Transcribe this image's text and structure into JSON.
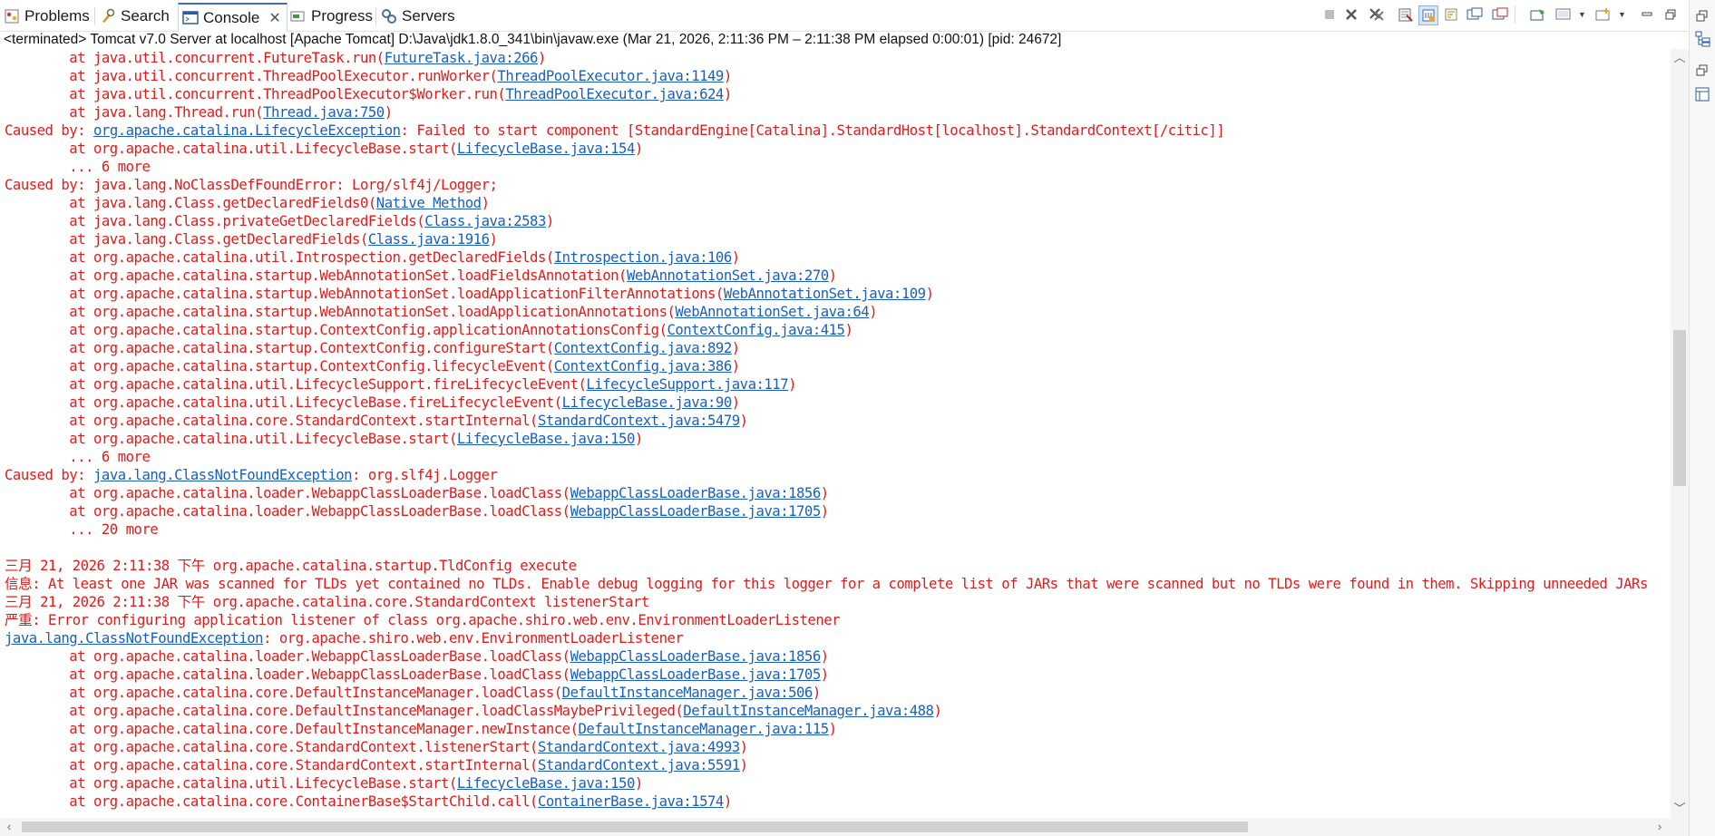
{
  "tabs": [
    {
      "label": "Problems",
      "icon": "problems-icon"
    },
    {
      "label": "Search",
      "icon": "search-icon"
    },
    {
      "label": "Console",
      "icon": "console-icon",
      "active": true
    },
    {
      "label": "Progress",
      "icon": "progress-icon"
    },
    {
      "label": "Servers",
      "icon": "servers-icon"
    }
  ],
  "toolbar_icons": [
    "terminate-icon",
    "remove-launch-icon",
    "remove-all-terminated-icon",
    "clear-console-icon",
    "scroll-lock-icon",
    "word-wrap-icon",
    "show-when-stdout-icon",
    "show-when-stderr-icon",
    "pin-console-icon",
    "display-selected-console-icon",
    "open-console-icon",
    "minimize-icon",
    "maximize-icon"
  ],
  "title": "<terminated> Tomcat v7.0 Server at localhost [Apache Tomcat] D:\\Java\\jdk1.8.0_341\\bin\\javaw.exe  (Mar 21, 2026, 2:11:36 PM – 2:11:38 PM elapsed 0:00:01) [pid: 24672]",
  "colors": {
    "error_text": "#e01b1b",
    "link": "#1a5fbf",
    "active_tab_accent": "#3a6fc4"
  },
  "lines": [
    {
      "pre": "        at java.util.concurrent.FutureTask.run(",
      "link": "FutureTask.java:266",
      "post": ")"
    },
    {
      "pre": "        at java.util.concurrent.ThreadPoolExecutor.runWorker(",
      "link": "ThreadPoolExecutor.java:1149",
      "post": ")"
    },
    {
      "pre": "        at java.util.concurrent.ThreadPoolExecutor$Worker.run(",
      "link": "ThreadPoolExecutor.java:624",
      "post": ")"
    },
    {
      "pre": "        at java.lang.Thread.run(",
      "link": "Thread.java:750",
      "post": ")"
    },
    {
      "pre": "Caused by: ",
      "link": "org.apache.catalina.LifecycleException",
      "post": ": Failed to start component [StandardEngine[Catalina].StandardHost[localhost].StandardContext[/citic]]"
    },
    {
      "pre": "        at org.apache.catalina.util.LifecycleBase.start(",
      "link": "LifecycleBase.java:154",
      "post": ")"
    },
    {
      "pre": "        ... 6 more",
      "link": "",
      "post": ""
    },
    {
      "pre": "Caused by: java.lang.NoClassDefFoundError: Lorg/slf4j/Logger;",
      "link": "",
      "post": ""
    },
    {
      "pre": "        at java.lang.Class.getDeclaredFields0(",
      "link": "Native Method",
      "post": ")"
    },
    {
      "pre": "        at java.lang.Class.privateGetDeclaredFields(",
      "link": "Class.java:2583",
      "post": ")"
    },
    {
      "pre": "        at java.lang.Class.getDeclaredFields(",
      "link": "Class.java:1916",
      "post": ")"
    },
    {
      "pre": "        at org.apache.catalina.util.Introspection.getDeclaredFields(",
      "link": "Introspection.java:106",
      "post": ")"
    },
    {
      "pre": "        at org.apache.catalina.startup.WebAnnotationSet.loadFieldsAnnotation(",
      "link": "WebAnnotationSet.java:270",
      "post": ")"
    },
    {
      "pre": "        at org.apache.catalina.startup.WebAnnotationSet.loadApplicationFilterAnnotations(",
      "link": "WebAnnotationSet.java:109",
      "post": ")"
    },
    {
      "pre": "        at org.apache.catalina.startup.WebAnnotationSet.loadApplicationAnnotations(",
      "link": "WebAnnotationSet.java:64",
      "post": ")"
    },
    {
      "pre": "        at org.apache.catalina.startup.ContextConfig.applicationAnnotationsConfig(",
      "link": "ContextConfig.java:415",
      "post": ")"
    },
    {
      "pre": "        at org.apache.catalina.startup.ContextConfig.configureStart(",
      "link": "ContextConfig.java:892",
      "post": ")"
    },
    {
      "pre": "        at org.apache.catalina.startup.ContextConfig.lifecycleEvent(",
      "link": "ContextConfig.java:386",
      "post": ")"
    },
    {
      "pre": "        at org.apache.catalina.util.LifecycleSupport.fireLifecycleEvent(",
      "link": "LifecycleSupport.java:117",
      "post": ")"
    },
    {
      "pre": "        at org.apache.catalina.util.LifecycleBase.fireLifecycleEvent(",
      "link": "LifecycleBase.java:90",
      "post": ")"
    },
    {
      "pre": "        at org.apache.catalina.core.StandardContext.startInternal(",
      "link": "StandardContext.java:5479",
      "post": ")"
    },
    {
      "pre": "        at org.apache.catalina.util.LifecycleBase.start(",
      "link": "LifecycleBase.java:150",
      "post": ")"
    },
    {
      "pre": "        ... 6 more",
      "link": "",
      "post": ""
    },
    {
      "pre": "Caused by: ",
      "link": "java.lang.ClassNotFoundException",
      "post": ": org.slf4j.Logger"
    },
    {
      "pre": "        at org.apache.catalina.loader.WebappClassLoaderBase.loadClass(",
      "link": "WebappClassLoaderBase.java:1856",
      "post": ")"
    },
    {
      "pre": "        at org.apache.catalina.loader.WebappClassLoaderBase.loadClass(",
      "link": "WebappClassLoaderBase.java:1705",
      "post": ")"
    },
    {
      "pre": "        ... 20 more",
      "link": "",
      "post": ""
    },
    {
      "pre": "",
      "link": "",
      "post": ""
    },
    {
      "pre": "三月 21, 2026 2:11:38 下午 org.apache.catalina.startup.TldConfig execute",
      "link": "",
      "post": ""
    },
    {
      "pre": "信息: At least one JAR was scanned for TLDs yet contained no TLDs. Enable debug logging for this logger for a complete list of JARs that were scanned but no TLDs were found in them. Skipping unneeded JARs",
      "link": "",
      "post": ""
    },
    {
      "pre": "三月 21, 2026 2:11:38 下午 org.apache.catalina.core.StandardContext listenerStart",
      "link": "",
      "post": ""
    },
    {
      "pre": "严重: Error configuring application listener of class org.apache.shiro.web.env.EnvironmentLoaderListener",
      "link": "",
      "post": ""
    },
    {
      "pre": "",
      "link": "java.lang.ClassNotFoundException",
      "post": ": org.apache.shiro.web.env.EnvironmentLoaderListener"
    },
    {
      "pre": "        at org.apache.catalina.loader.WebappClassLoaderBase.loadClass(",
      "link": "WebappClassLoaderBase.java:1856",
      "post": ")"
    },
    {
      "pre": "        at org.apache.catalina.loader.WebappClassLoaderBase.loadClass(",
      "link": "WebappClassLoaderBase.java:1705",
      "post": ")"
    },
    {
      "pre": "        at org.apache.catalina.core.DefaultInstanceManager.loadClass(",
      "link": "DefaultInstanceManager.java:506",
      "post": ")"
    },
    {
      "pre": "        at org.apache.catalina.core.DefaultInstanceManager.loadClassMaybePrivileged(",
      "link": "DefaultInstanceManager.java:488",
      "post": ")"
    },
    {
      "pre": "        at org.apache.catalina.core.DefaultInstanceManager.newInstance(",
      "link": "DefaultInstanceManager.java:115",
      "post": ")"
    },
    {
      "pre": "        at org.apache.catalina.core.StandardContext.listenerStart(",
      "link": "StandardContext.java:4993",
      "post": ")"
    },
    {
      "pre": "        at org.apache.catalina.core.StandardContext.startInternal(",
      "link": "StandardContext.java:5591",
      "post": ")"
    },
    {
      "pre": "        at org.apache.catalina.util.LifecycleBase.start(",
      "link": "LifecycleBase.java:150",
      "post": ")"
    },
    {
      "pre": "        at org.apache.catalina.core.ContainerBase$StartChild.call(",
      "link": "ContainerBase.java:1574",
      "post": ")"
    }
  ]
}
